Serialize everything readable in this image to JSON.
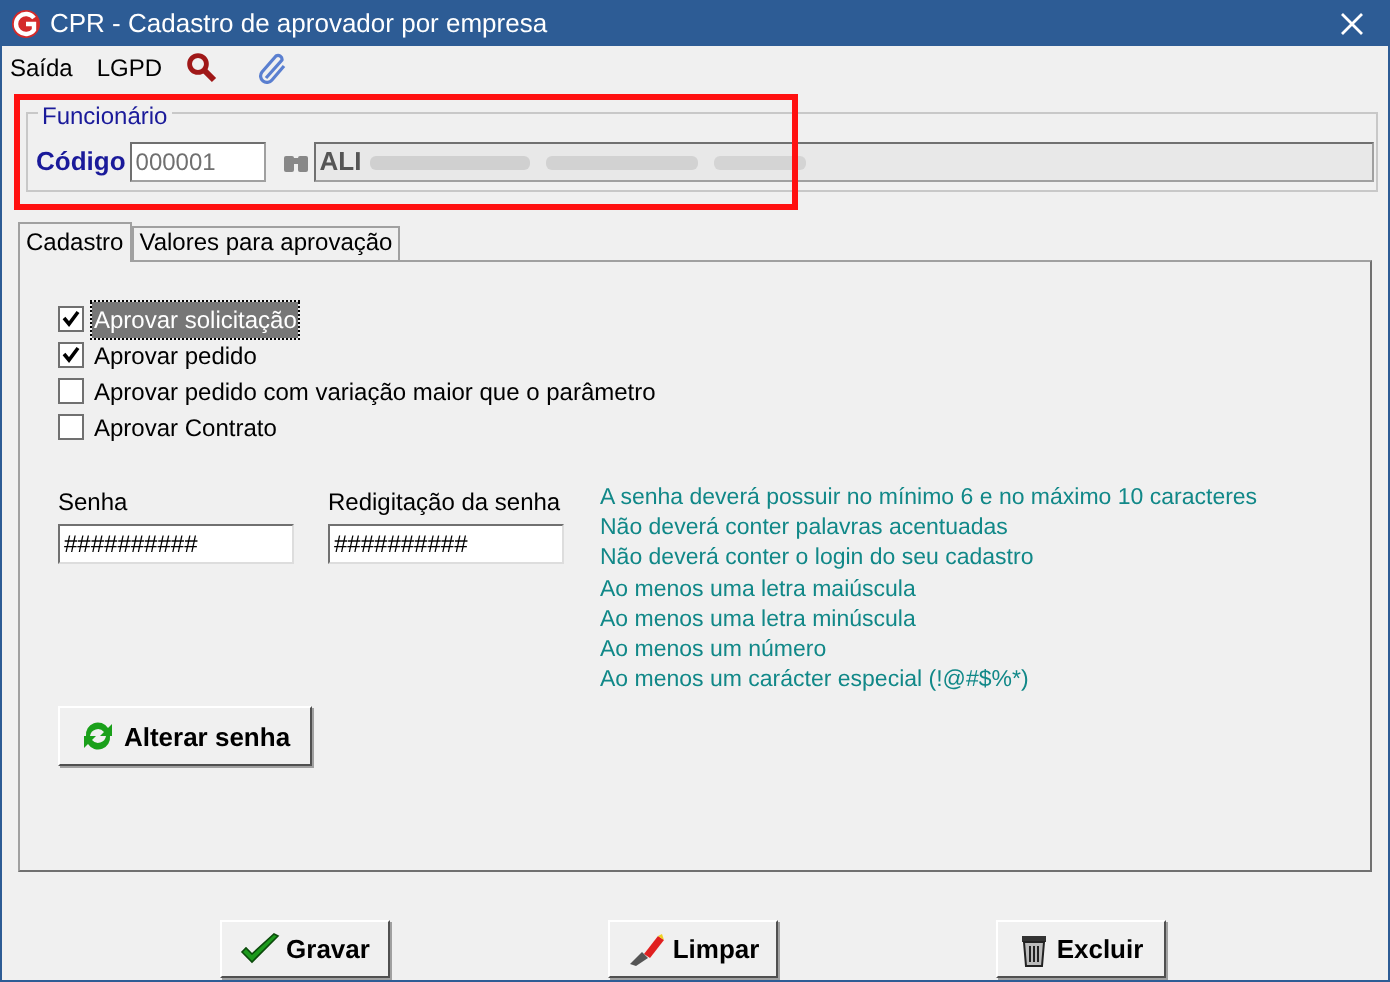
{
  "window": {
    "title": "CPR - Cadastro de aprovador por empresa"
  },
  "menu": [
    "Saída",
    "LGPD"
  ],
  "funcionario": {
    "legend": "Funcionário",
    "code_label": "Código",
    "code_value": "000001",
    "name_value": "ALI",
    "highlighted": true
  },
  "tabs": [
    {
      "label": "Cadastro",
      "selected": true
    },
    {
      "label": "Valores para aprovação",
      "selected": false
    }
  ],
  "permissions": [
    {
      "label": "Aprovar solicitação",
      "checked": true,
      "focused": true
    },
    {
      "label": "Aprovar pedido",
      "checked": true,
      "focused": false
    },
    {
      "label": "Aprovar pedido com variação maior que o parâmetro",
      "checked": false,
      "focused": false
    },
    {
      "label": "Aprovar Contrato",
      "checked": false,
      "focused": false
    }
  ],
  "password": {
    "label": "Senha",
    "value": "##########"
  },
  "password_confirm": {
    "label": "Redigitação da senha",
    "value": "##########"
  },
  "rules": [
    "A senha deverá possuir no mínimo 6 e no máximo 10 caracteres",
    "Não deverá conter palavras acentuadas",
    "Não deverá conter o login do seu cadastro",
    "Ao menos uma letra maiúscula",
    "Ao menos uma letra minúscula",
    "Ao menos um número",
    "Ao menos um carácter especial (!@#$%*)"
  ],
  "change_password_button": "Alterar senha",
  "buttons": [
    {
      "kind": "save",
      "label": "Gravar"
    },
    {
      "kind": "clear",
      "label": "Limpar"
    },
    {
      "kind": "delete",
      "label": "Excluir"
    }
  ]
}
